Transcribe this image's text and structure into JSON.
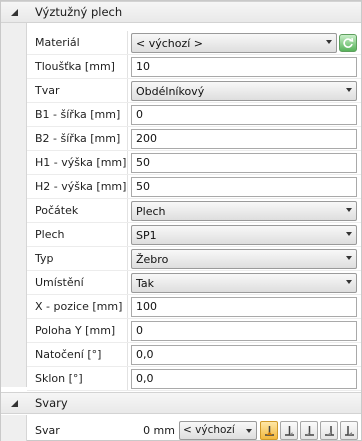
{
  "section_plate": {
    "title": "Výztužný plech",
    "rows": [
      {
        "label": "Materiál",
        "value": "< výchozí >"
      },
      {
        "label": "Tloušťka [mm]",
        "value": "10"
      },
      {
        "label": "Tvar",
        "value": "Obdélníkový"
      },
      {
        "label": "B1 - šířka [mm]",
        "value": "0"
      },
      {
        "label": "B2 - šířka [mm]",
        "value": "200"
      },
      {
        "label": "H1 - výška [mm]",
        "value": "50"
      },
      {
        "label": "H2 - výška [mm]",
        "value": "50"
      },
      {
        "label": "Počátek",
        "value": "Plech"
      },
      {
        "label": "Plech",
        "value": "SP1"
      },
      {
        "label": "Typ",
        "value": "Žebro"
      },
      {
        "label": "Umístění",
        "value": "Tak"
      },
      {
        "label": "X - pozice [mm]",
        "value": "100"
      },
      {
        "label": "Poloha Y [mm]",
        "value": "0"
      },
      {
        "label": "Natočení [°]",
        "value": "0,0"
      },
      {
        "label": "Sklon [°]",
        "value": "0,0"
      }
    ]
  },
  "section_welds": {
    "title": "Svary",
    "weld": {
      "label": "Svar",
      "size": "0 mm",
      "type": "< výchozí",
      "buttons": [
        "weld-type-1-icon",
        "weld-type-2-icon",
        "weld-type-3-icon",
        "weld-type-4-icon",
        "weld-type-5-icon"
      ]
    }
  },
  "colors": {
    "active_weld": "#f2b83e",
    "refresh": "#57b35a"
  }
}
